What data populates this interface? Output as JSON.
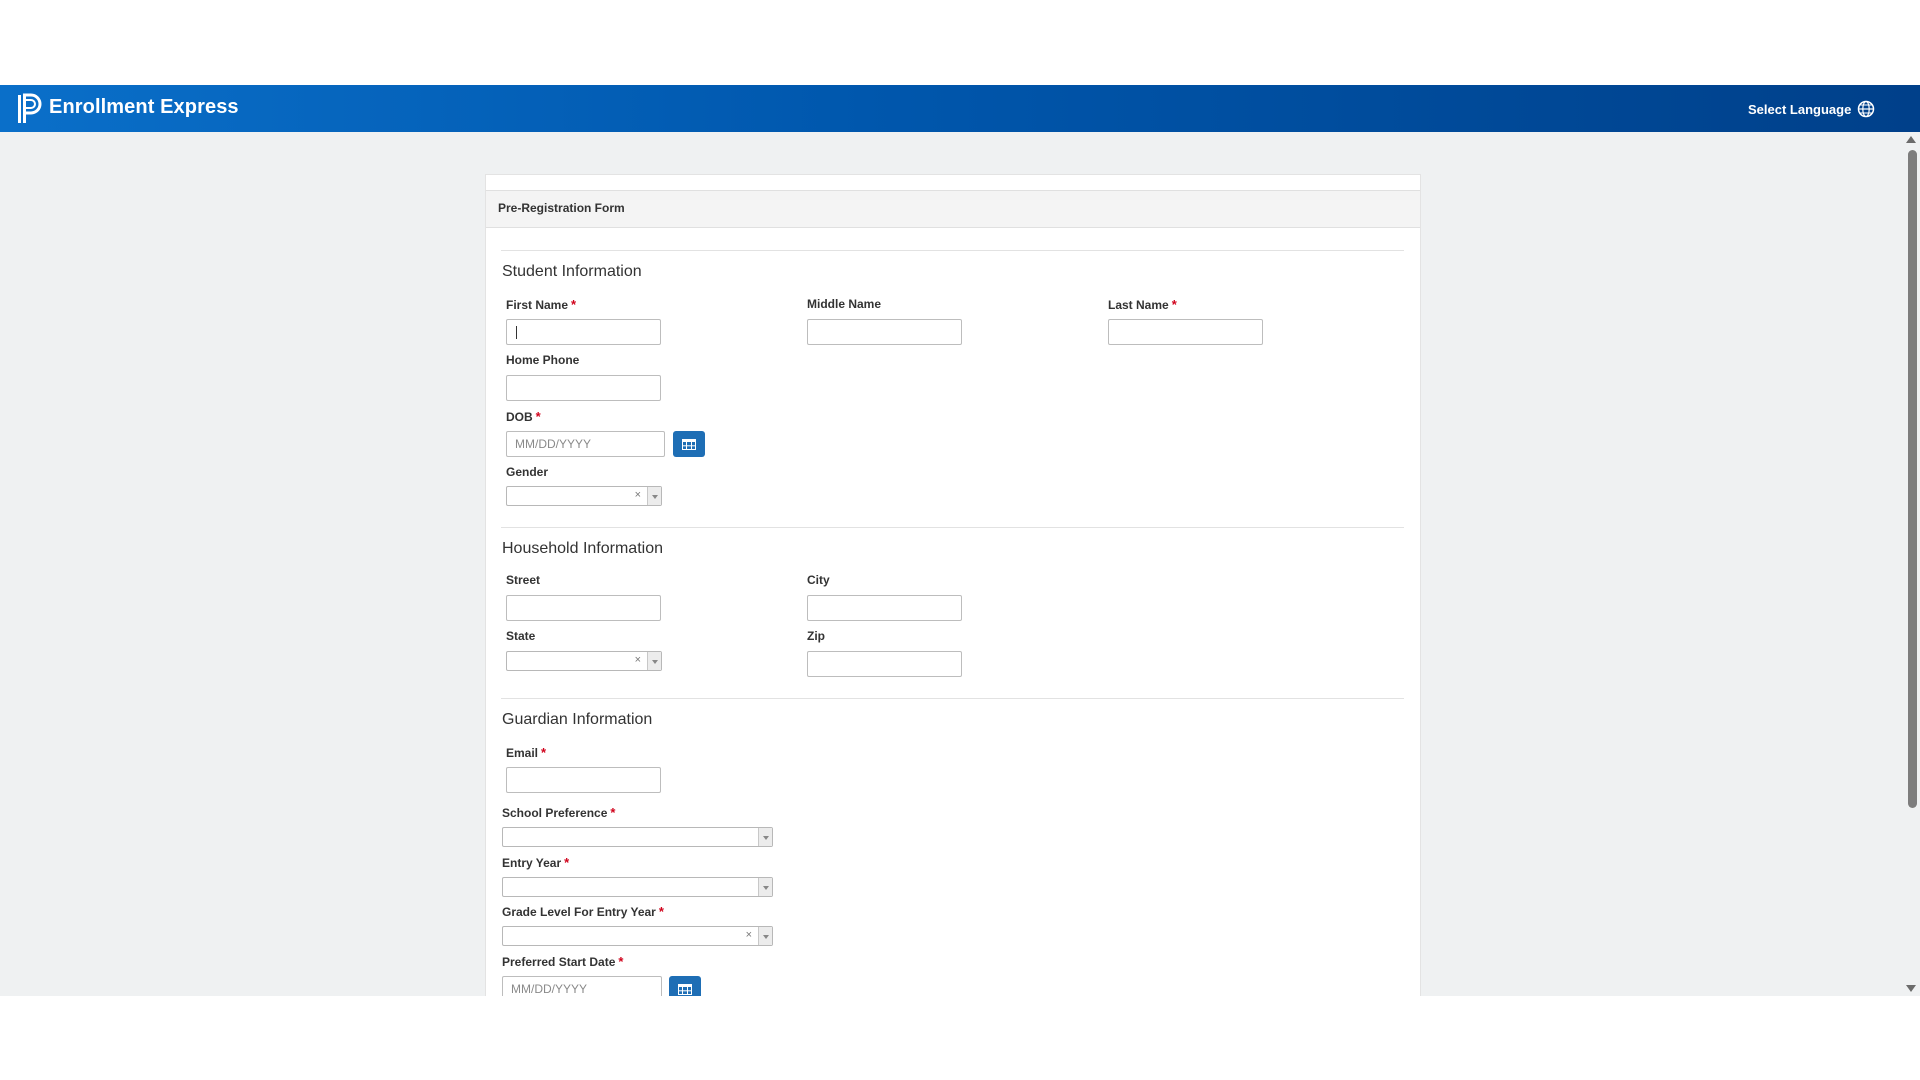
{
  "header": {
    "app_title": "Enrollment Express",
    "language_label": "Select Language",
    "brand_color": "#0057ad"
  },
  "form": {
    "title": "Pre-Registration Form",
    "required_marker": "*",
    "sections": {
      "student": {
        "title": "Student Information",
        "first_name": {
          "label": "First Name",
          "value": "",
          "required": true
        },
        "middle_name": {
          "label": "Middle Name",
          "value": ""
        },
        "last_name": {
          "label": "Last Name",
          "value": "",
          "required": true
        },
        "home_phone": {
          "label": "Home Phone",
          "value": ""
        },
        "dob": {
          "label": "DOB",
          "placeholder": "MM/DD/YYYY",
          "required": true
        },
        "gender": {
          "label": "Gender",
          "selected": "",
          "clear_glyph": "×"
        }
      },
      "household": {
        "title": "Household Information",
        "street": {
          "label": "Street",
          "value": ""
        },
        "city": {
          "label": "City",
          "value": ""
        },
        "state": {
          "label": "State",
          "selected": "",
          "clear_glyph": "×"
        },
        "zip": {
          "label": "Zip",
          "value": ""
        }
      },
      "guardian": {
        "title": "Guardian Information",
        "email": {
          "label": "Email",
          "value": "",
          "required": true
        },
        "school_preference": {
          "label": "School Preference",
          "selected": "",
          "required": true
        },
        "entry_year": {
          "label": "Entry Year",
          "selected": "",
          "required": true
        },
        "grade_level": {
          "label": "Grade Level For Entry Year",
          "selected": "",
          "required": true,
          "clear_glyph": "×"
        },
        "preferred_start_date": {
          "label": "Preferred Start Date",
          "placeholder": "MM/DD/YYYY",
          "required": true
        }
      }
    }
  },
  "icons": {
    "logo": "powerschool-logo-icon",
    "globe": "globe-icon",
    "calendar": "calendar-icon",
    "dropdown": "chevron-down-icon",
    "clear": "close-icon"
  },
  "colors": {
    "required": "#d0021b",
    "calendar_button": "#1e6eb5",
    "page_background": "#eff1f2"
  }
}
